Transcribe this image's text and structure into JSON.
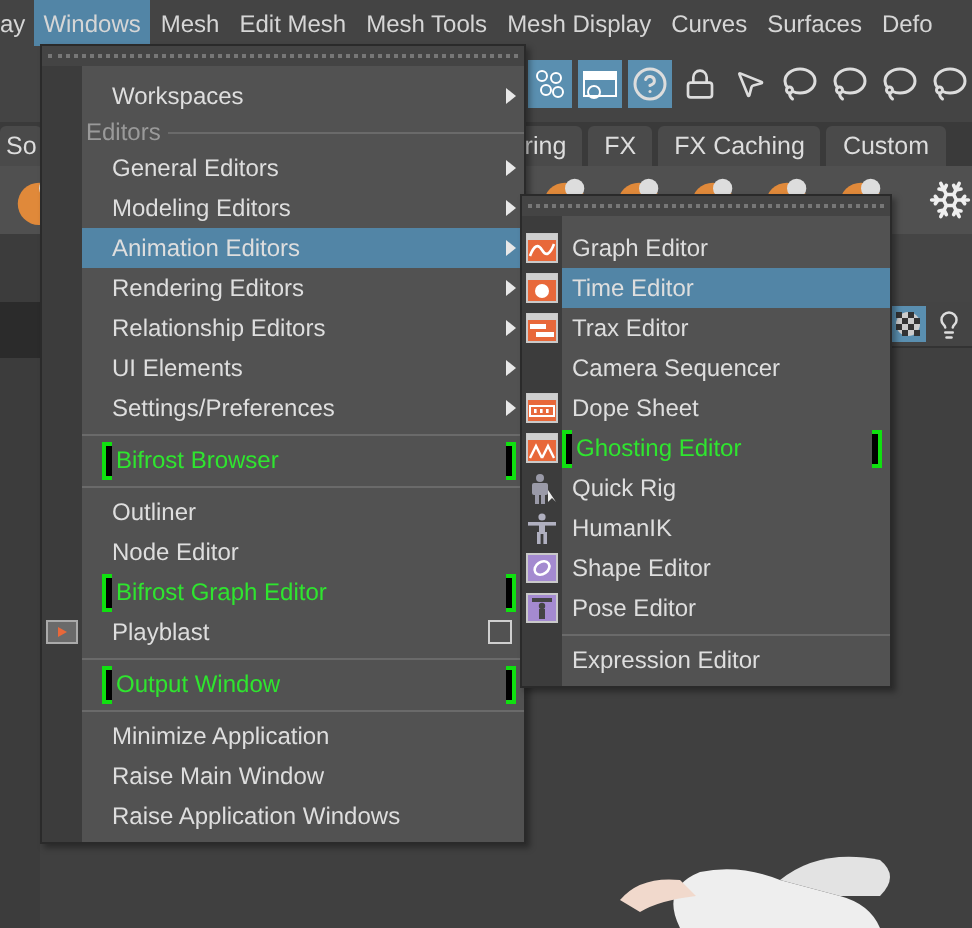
{
  "menubar": [
    {
      "label": "ay",
      "selected": false
    },
    {
      "label": "Windows",
      "selected": true
    },
    {
      "label": "Mesh",
      "selected": false
    },
    {
      "label": "Edit Mesh",
      "selected": false
    },
    {
      "label": "Mesh Tools",
      "selected": false
    },
    {
      "label": "Mesh Display",
      "selected": false
    },
    {
      "label": "Curves",
      "selected": false
    },
    {
      "label": "Surfaces",
      "selected": false
    },
    {
      "label": "Defo",
      "selected": false
    }
  ],
  "shelf_tabs": [
    {
      "label": "So"
    },
    {
      "label": "ring"
    },
    {
      "label": "FX"
    },
    {
      "label": "FX Caching"
    },
    {
      "label": "Custom"
    }
  ],
  "windows_menu": {
    "items": [
      {
        "kind": "item",
        "label": "Workspaces",
        "submenu": true,
        "marked": false,
        "selected": false
      },
      {
        "kind": "header",
        "label": "Editors"
      },
      {
        "kind": "item",
        "label": "General Editors",
        "submenu": true,
        "marked": false,
        "selected": false
      },
      {
        "kind": "item",
        "label": "Modeling Editors",
        "submenu": true,
        "marked": false,
        "selected": false
      },
      {
        "kind": "item",
        "label": "Animation Editors",
        "submenu": true,
        "marked": false,
        "selected": true
      },
      {
        "kind": "item",
        "label": "Rendering Editors",
        "submenu": true,
        "marked": false,
        "selected": false
      },
      {
        "kind": "item",
        "label": "Relationship Editors",
        "submenu": true,
        "marked": false,
        "selected": false
      },
      {
        "kind": "item",
        "label": "UI Elements",
        "submenu": true,
        "marked": false,
        "selected": false
      },
      {
        "kind": "item",
        "label": "Settings/Preferences",
        "submenu": true,
        "marked": false,
        "selected": false
      },
      {
        "kind": "separator"
      },
      {
        "kind": "item",
        "label": "Bifrost Browser",
        "submenu": false,
        "marked": true,
        "selected": false
      },
      {
        "kind": "separator"
      },
      {
        "kind": "item",
        "label": "Outliner",
        "submenu": false,
        "marked": false,
        "selected": false
      },
      {
        "kind": "item",
        "label": "Node Editor",
        "submenu": false,
        "marked": false,
        "selected": false
      },
      {
        "kind": "item",
        "label": "Bifrost Graph Editor",
        "submenu": false,
        "marked": true,
        "selected": false
      },
      {
        "kind": "item",
        "label": "Playblast",
        "submenu": false,
        "marked": false,
        "selected": false,
        "option_box": true
      },
      {
        "kind": "separator"
      },
      {
        "kind": "item",
        "label": "Output Window",
        "submenu": false,
        "marked": true,
        "selected": false
      },
      {
        "kind": "separator"
      },
      {
        "kind": "item",
        "label": "Minimize Application",
        "submenu": false,
        "marked": false,
        "selected": false
      },
      {
        "kind": "item",
        "label": "Raise Main Window",
        "submenu": false,
        "marked": false,
        "selected": false
      },
      {
        "kind": "item",
        "label": "Raise Application Windows",
        "submenu": false,
        "marked": false,
        "selected": false
      }
    ]
  },
  "animation_submenu": {
    "items": [
      {
        "kind": "item",
        "label": "Graph Editor",
        "marked": false,
        "selected": false
      },
      {
        "kind": "item",
        "label": "Time Editor",
        "marked": false,
        "selected": true
      },
      {
        "kind": "item",
        "label": "Trax Editor",
        "marked": false,
        "selected": false
      },
      {
        "kind": "item",
        "label": "Camera Sequencer",
        "marked": false,
        "selected": false
      },
      {
        "kind": "item",
        "label": "Dope Sheet",
        "marked": false,
        "selected": false
      },
      {
        "kind": "item",
        "label": "Ghosting Editor",
        "marked": true,
        "selected": false
      },
      {
        "kind": "item",
        "label": "Quick Rig",
        "marked": false,
        "selected": false
      },
      {
        "kind": "item",
        "label": "HumanIK",
        "marked": false,
        "selected": false
      },
      {
        "kind": "item",
        "label": "Shape Editor",
        "marked": false,
        "selected": false
      },
      {
        "kind": "item",
        "label": "Pose Editor",
        "marked": false,
        "selected": false
      },
      {
        "kind": "separator"
      },
      {
        "kind": "item",
        "label": "Expression Editor",
        "marked": false,
        "selected": false
      }
    ]
  }
}
